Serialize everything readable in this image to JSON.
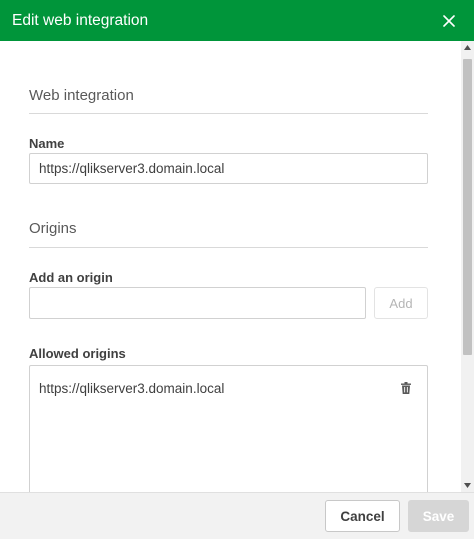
{
  "dialog": {
    "title": "Edit web integration",
    "close_icon": "close-icon"
  },
  "web_integration_section": {
    "title": "Web integration",
    "name_label": "Name",
    "name_value": "https://qlikserver3.domain.local"
  },
  "origins_section": {
    "title": "Origins",
    "add_label": "Add an origin",
    "add_input_value": "",
    "add_button_label": "Add",
    "allowed_label": "Allowed origins",
    "allowed_origins": [
      {
        "url": "https://qlikserver3.domain.local",
        "delete_icon": "trash-icon"
      }
    ]
  },
  "footer": {
    "cancel_label": "Cancel",
    "save_label": "Save"
  },
  "colors": {
    "header": "#00953a",
    "save_disabled": "#d6d6d6"
  }
}
